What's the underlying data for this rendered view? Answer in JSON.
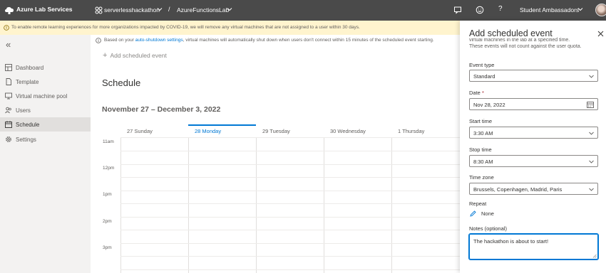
{
  "topbar": {
    "app_title": "Azure Lab Services",
    "lab_plan": "serverlesshackathon",
    "separator": "/",
    "lab": "AzureFunctionsLab",
    "help_label": "?",
    "user": "Student Ambassadors"
  },
  "banner": {
    "text": "To enable remote learning experiences for more organizations impacted by COVID-19, we will remove any virtual machines that are not assigned to a user within 30 days."
  },
  "info": {
    "prefix": "Based on your ",
    "link": "auto-shutdown settings",
    "suffix": ", virtual machines will automatically shut down when users don't connect within 15 minutes of the scheduled event starting."
  },
  "sidebar": {
    "collapse_glyph": "«",
    "items": [
      {
        "label": "Dashboard",
        "icon": "dashboard-icon"
      },
      {
        "label": "Template",
        "icon": "template-icon"
      },
      {
        "label": "Virtual machine pool",
        "icon": "vm-pool-icon"
      },
      {
        "label": "Users",
        "icon": "users-icon"
      },
      {
        "label": "Schedule",
        "icon": "schedule-icon",
        "active": true
      },
      {
        "label": "Settings",
        "icon": "settings-icon"
      }
    ]
  },
  "main": {
    "add_event_label": "Add scheduled event",
    "title": "Schedule",
    "week_range": "November 27 – December 3, 2022",
    "days": [
      "27 Sunday",
      "28 Monday",
      "29 Tuesday",
      "30 Wednesday",
      "1 Thursday"
    ],
    "today_index": 1,
    "hours": [
      "11am",
      "12pm",
      "1pm",
      "2pm",
      "3pm"
    ]
  },
  "panel": {
    "title": "Add scheduled event",
    "desc_line1": "virtual machines in the lab at a specified time.",
    "desc_line2": "These events will not count against the user quota.",
    "event_type_label": "Event type",
    "event_type_value": "Standard",
    "date_label": "Date",
    "required_mark": "*",
    "date_value": "Nov 28, 2022",
    "start_time_label": "Start time",
    "start_time_value": "3:30 AM",
    "stop_time_label": "Stop time",
    "stop_time_value": "8:30 AM",
    "time_zone_label": "Time zone",
    "time_zone_value": "Brussels, Copenhagen, Madrid, Paris",
    "repeat_label": "Repeat",
    "repeat_value": "None",
    "notes_label": "Notes (optional)",
    "notes_value": "The hackathon is about to start!"
  }
}
